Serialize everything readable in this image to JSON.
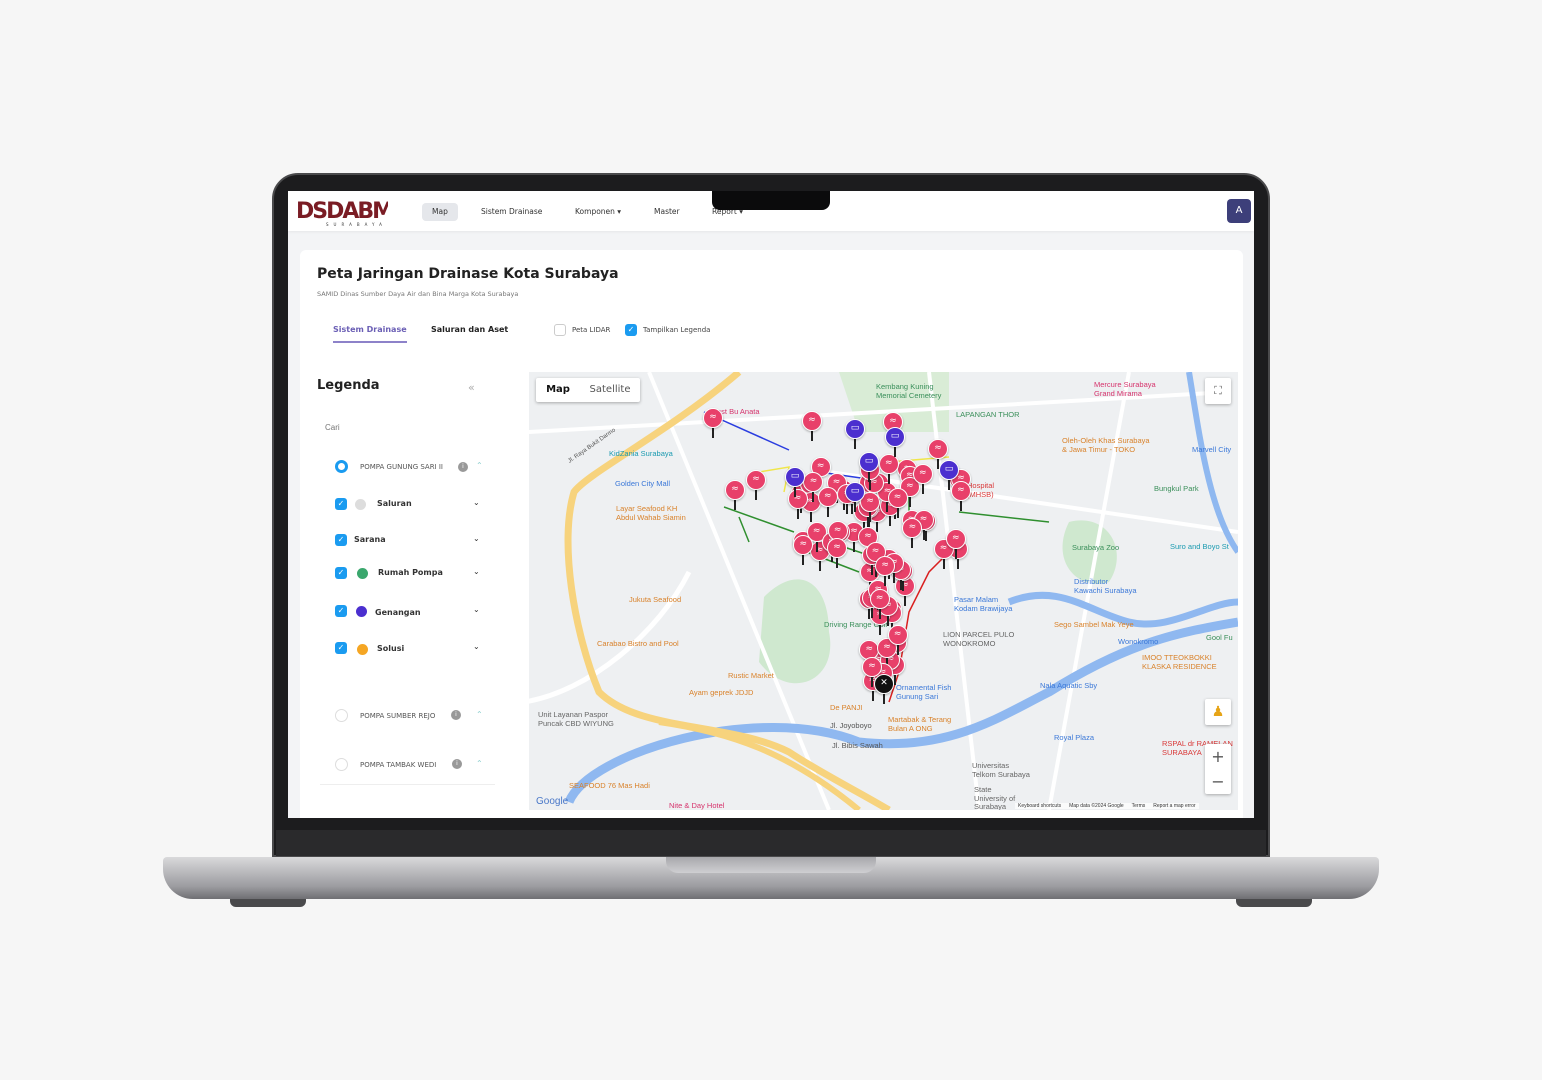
{
  "nav": {
    "logo": "DSDABM SURABAYA",
    "items": [
      {
        "label": "Map",
        "active": true
      },
      {
        "label": "Sistem Drainase"
      },
      {
        "label": "Komponen ▾"
      },
      {
        "label": "Master"
      },
      {
        "label": "Report ▾"
      }
    ],
    "avatar": "A"
  },
  "page": {
    "title": "Peta Jaringan Drainase Kota Surabaya",
    "subtitle": "SAMID Dinas Sumber Daya Air dan Bina Marga Kota Surabaya",
    "tabs": [
      {
        "label": "Sistem Drainase",
        "active": true
      },
      {
        "label": "Saluran dan Aset"
      }
    ],
    "toggles": [
      {
        "label": "Peta LIDAR",
        "checked": false
      },
      {
        "label": "Tampilkan Legenda",
        "checked": true
      }
    ]
  },
  "legend": {
    "title": "Legenda",
    "collapse_icon": "double-chevron-left-icon",
    "search_placeholder": "Cari",
    "groups": [
      {
        "label": "POMPA GUNUNG SARI II",
        "selected": true
      },
      {
        "label": "POMPA SUMBER REJO",
        "selected": false
      },
      {
        "label": "POMPA TAMBAK WEDI",
        "selected": false
      }
    ],
    "layers": [
      {
        "label": "Saluran",
        "checked": true,
        "color": "#d9d9d9"
      },
      {
        "label": "Sarana",
        "checked": true,
        "color": ""
      },
      {
        "label": "Rumah Pompa",
        "checked": true,
        "color": "#3aa76d"
      },
      {
        "label": "Genangan",
        "checked": true,
        "color": "#4b2fcf"
      },
      {
        "label": "Solusi",
        "checked": true,
        "color": "#f5a623"
      }
    ],
    "check_color": "#1a9bf0"
  },
  "map": {
    "type_buttons": [
      {
        "label": "Map",
        "active": true
      },
      {
        "label": "Satellite"
      }
    ],
    "marker_colors": {
      "solusi": "#e8406a",
      "genangan": "#4b2fcf",
      "pompa": "#111111"
    },
    "labels": [
      {
        "text": "Kembang Kuning\nMemorial Cemetery",
        "color": "#3a8f5a"
      },
      {
        "text": "Mercure Surabaya\nGrand Mirama",
        "color": "#d6336c"
      },
      {
        "text": "LAPANGAN THOR",
        "color": "#3a8f5a"
      },
      {
        "text": "Oleh-Oleh Khas Surabaya\n& Jawa Timur - TOKO",
        "color": "#d9822b"
      },
      {
        "text": "Marvell City",
        "color": "#3b78d8"
      },
      {
        "text": "Bungkul Park",
        "color": "#3a8f5a"
      },
      {
        "text": "Hospital\n(MHSB)",
        "color": "#d93838"
      },
      {
        "text": "Surabaya Zoo",
        "color": "#3a8f5a"
      },
      {
        "text": "Suro and Boyo St",
        "color": "#1a9ab0"
      },
      {
        "text": "Distributor\nKawachi Surabaya",
        "color": "#3b78d8"
      },
      {
        "text": "Pasar Malam\nKodam Brawijaya",
        "color": "#3b78d8"
      },
      {
        "text": "Sego Sambel Mak Yeye",
        "color": "#d9822b"
      },
      {
        "text": "LION PARCEL PULO\nWONOKROMO",
        "color": "#666666"
      },
      {
        "text": "Wonokromo",
        "color": "#3b78d8"
      },
      {
        "text": "Gool Fu",
        "color": "#3a8f5a"
      },
      {
        "text": "IMOO TTEOKBOKKI\nKLASKA RESIDENCE",
        "color": "#d9822b"
      },
      {
        "text": "Nala Aquatic Sby",
        "color": "#3b78d8"
      },
      {
        "text": "Royal Plaza",
        "color": "#3b78d8"
      },
      {
        "text": "RSPAL dr RAMELAN\nSURABAYA",
        "color": "#d93838"
      },
      {
        "text": "Universitas\nTelkom Surabaya",
        "color": "#666666"
      },
      {
        "text": "State\nUniversity of\nSurabaya",
        "color": "#666666"
      },
      {
        "text": "KidZania Surabaya",
        "color": "#1a9ab0"
      },
      {
        "text": "Golden City Mall",
        "color": "#3b78d8"
      },
      {
        "text": "Layar Seafood KH\nAbdul Wahab Siamin",
        "color": "#d9822b"
      },
      {
        "text": "Jukuta Seafood",
        "color": "#d9822b"
      },
      {
        "text": "Carabao Bistro and Pool",
        "color": "#d9822b"
      },
      {
        "text": "Rustic Market",
        "color": "#d9822b"
      },
      {
        "text": "Ayam geprek JDJD",
        "color": "#d9822b"
      },
      {
        "text": "De PANJI",
        "color": "#d9822b"
      },
      {
        "text": "Unit Layanan Paspor\nPuncak CBD WIYUNG",
        "color": "#666666"
      },
      {
        "text": "Martabak & Terang\nBulan A ONG",
        "color": "#d9822b"
      },
      {
        "text": "Jl. Joyoboyo",
        "color": "#555555"
      },
      {
        "text": "Jl. Bibis Sawah",
        "color": "#555555"
      },
      {
        "text": "SEAFOOD 76 Mas Hadi",
        "color": "#d9822b"
      },
      {
        "text": "Nite & Day Hotel",
        "color": "#d6336c"
      },
      {
        "text": "Kost Bu Anata",
        "color": "#d6336c"
      },
      {
        "text": "Ornamental Fish\nGunung Sari",
        "color": "#3b78d8"
      },
      {
        "text": "Driving Range Golf",
        "color": "#3a8f5a"
      },
      {
        "text": "Jl. Raya Bukit Darmo",
        "color": "#555555"
      }
    ],
    "google_logo": "Google",
    "attribution": [
      "Keyboard shortcuts",
      "Map data ©2024 Google",
      "Terms",
      "Report a map error"
    ],
    "zoom_in": "+",
    "zoom_out": "−"
  }
}
